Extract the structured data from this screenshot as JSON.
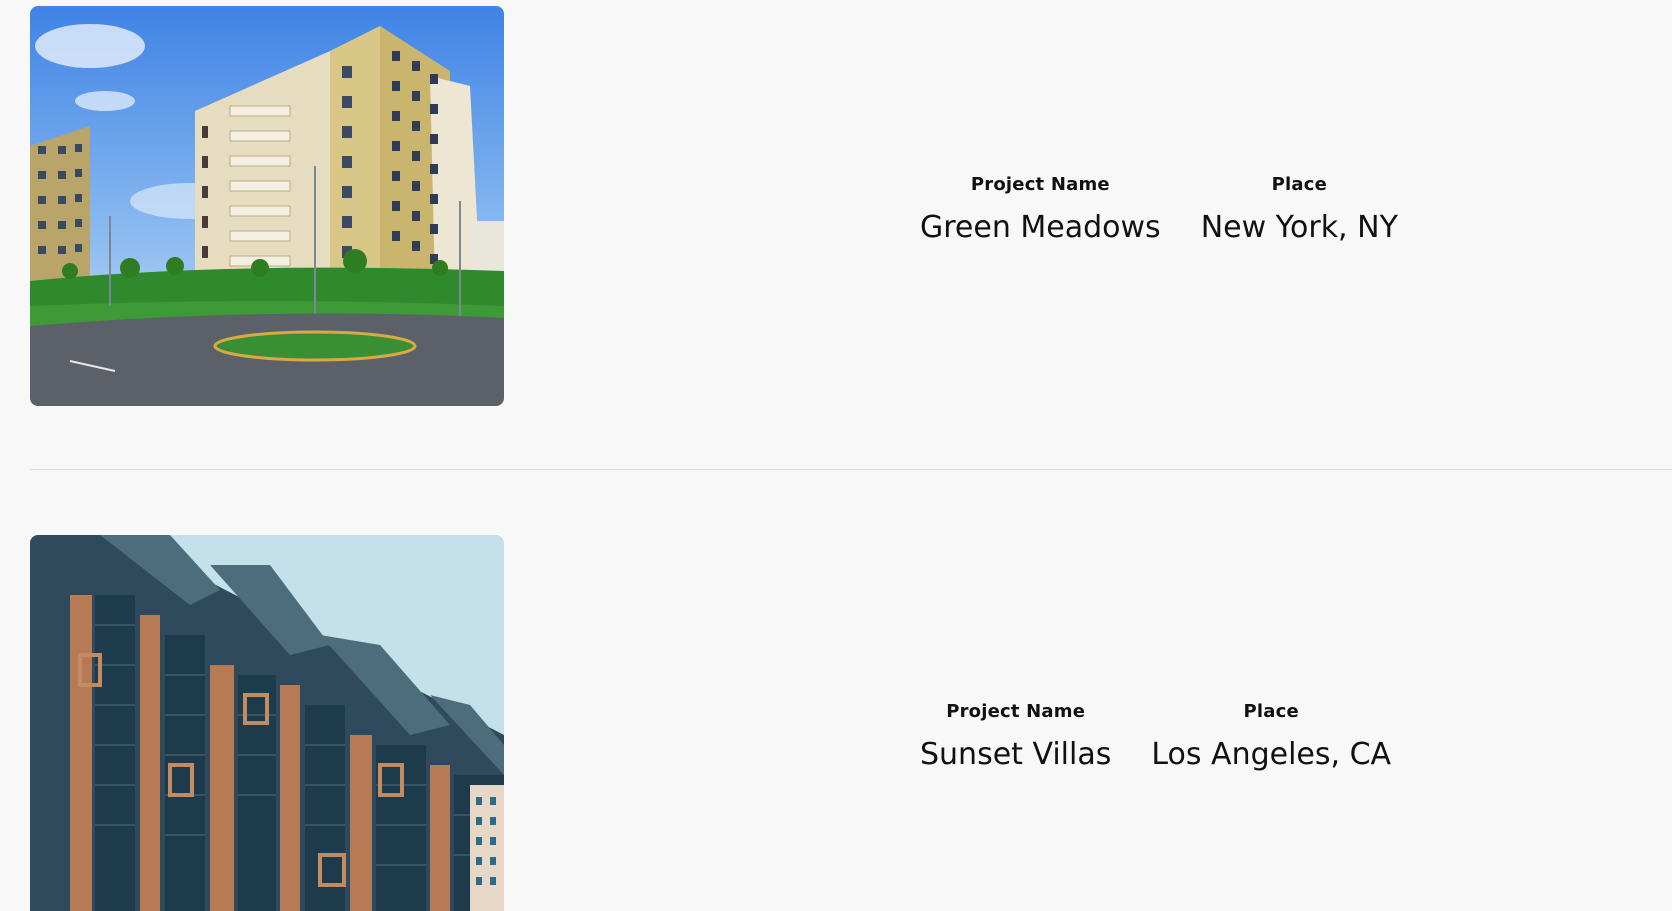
{
  "projects": [
    {
      "image_alt": "Residential apartment towers",
      "name_label": "Project Name",
      "name_value": "Green Meadows",
      "place_label": "Place",
      "place_value": "New York, NY"
    },
    {
      "image_alt": "High-rise glass skyscraper",
      "name_label": "Project Name",
      "name_value": "Sunset Villas",
      "place_label": "Place",
      "place_value": "Los Angeles, CA"
    }
  ]
}
